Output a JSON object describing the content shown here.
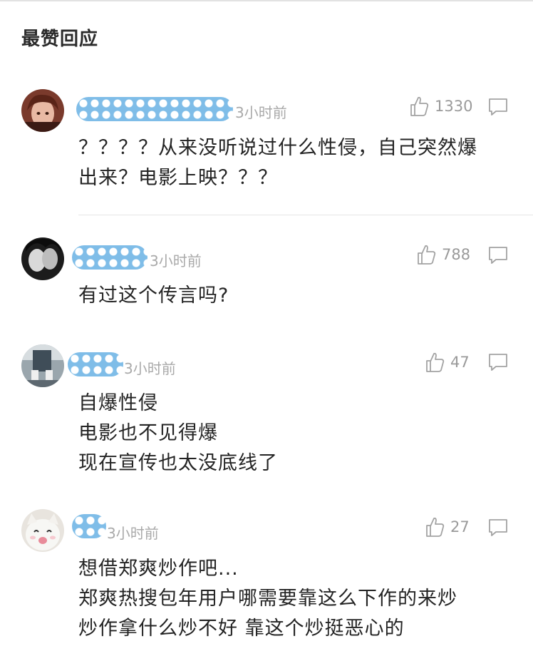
{
  "section": {
    "title": "最赞回应"
  },
  "comments": [
    {
      "time": "3小时前",
      "likes": "1330",
      "lines": [
        "？？？？从来没听说过什么性侵，自己突然爆",
        "出来？电影上映？？？"
      ]
    },
    {
      "time": "3小时前",
      "likes": "788",
      "lines": [
        "有过这个传言吗?"
      ]
    },
    {
      "time": "3小时前",
      "likes": "47",
      "lines": [
        "自爆性侵",
        "电影也不见得爆",
        "现在宣传也太没底线了"
      ]
    },
    {
      "time": "3小时前",
      "likes": "27",
      "lines": [
        "想借郑爽炒作吧...",
        "郑爽热搜包年用户哪需要靠这么下作的来炒",
        "炒作拿什么炒不好 靠这个炒挺恶心的"
      ]
    }
  ],
  "icons": {
    "like": "thumbs-up-icon",
    "reply": "comment-bubble-icon"
  },
  "colors": {
    "name_blur": "#7fbde8",
    "meta_text": "#a9a9a9",
    "body_text": "#232323"
  }
}
